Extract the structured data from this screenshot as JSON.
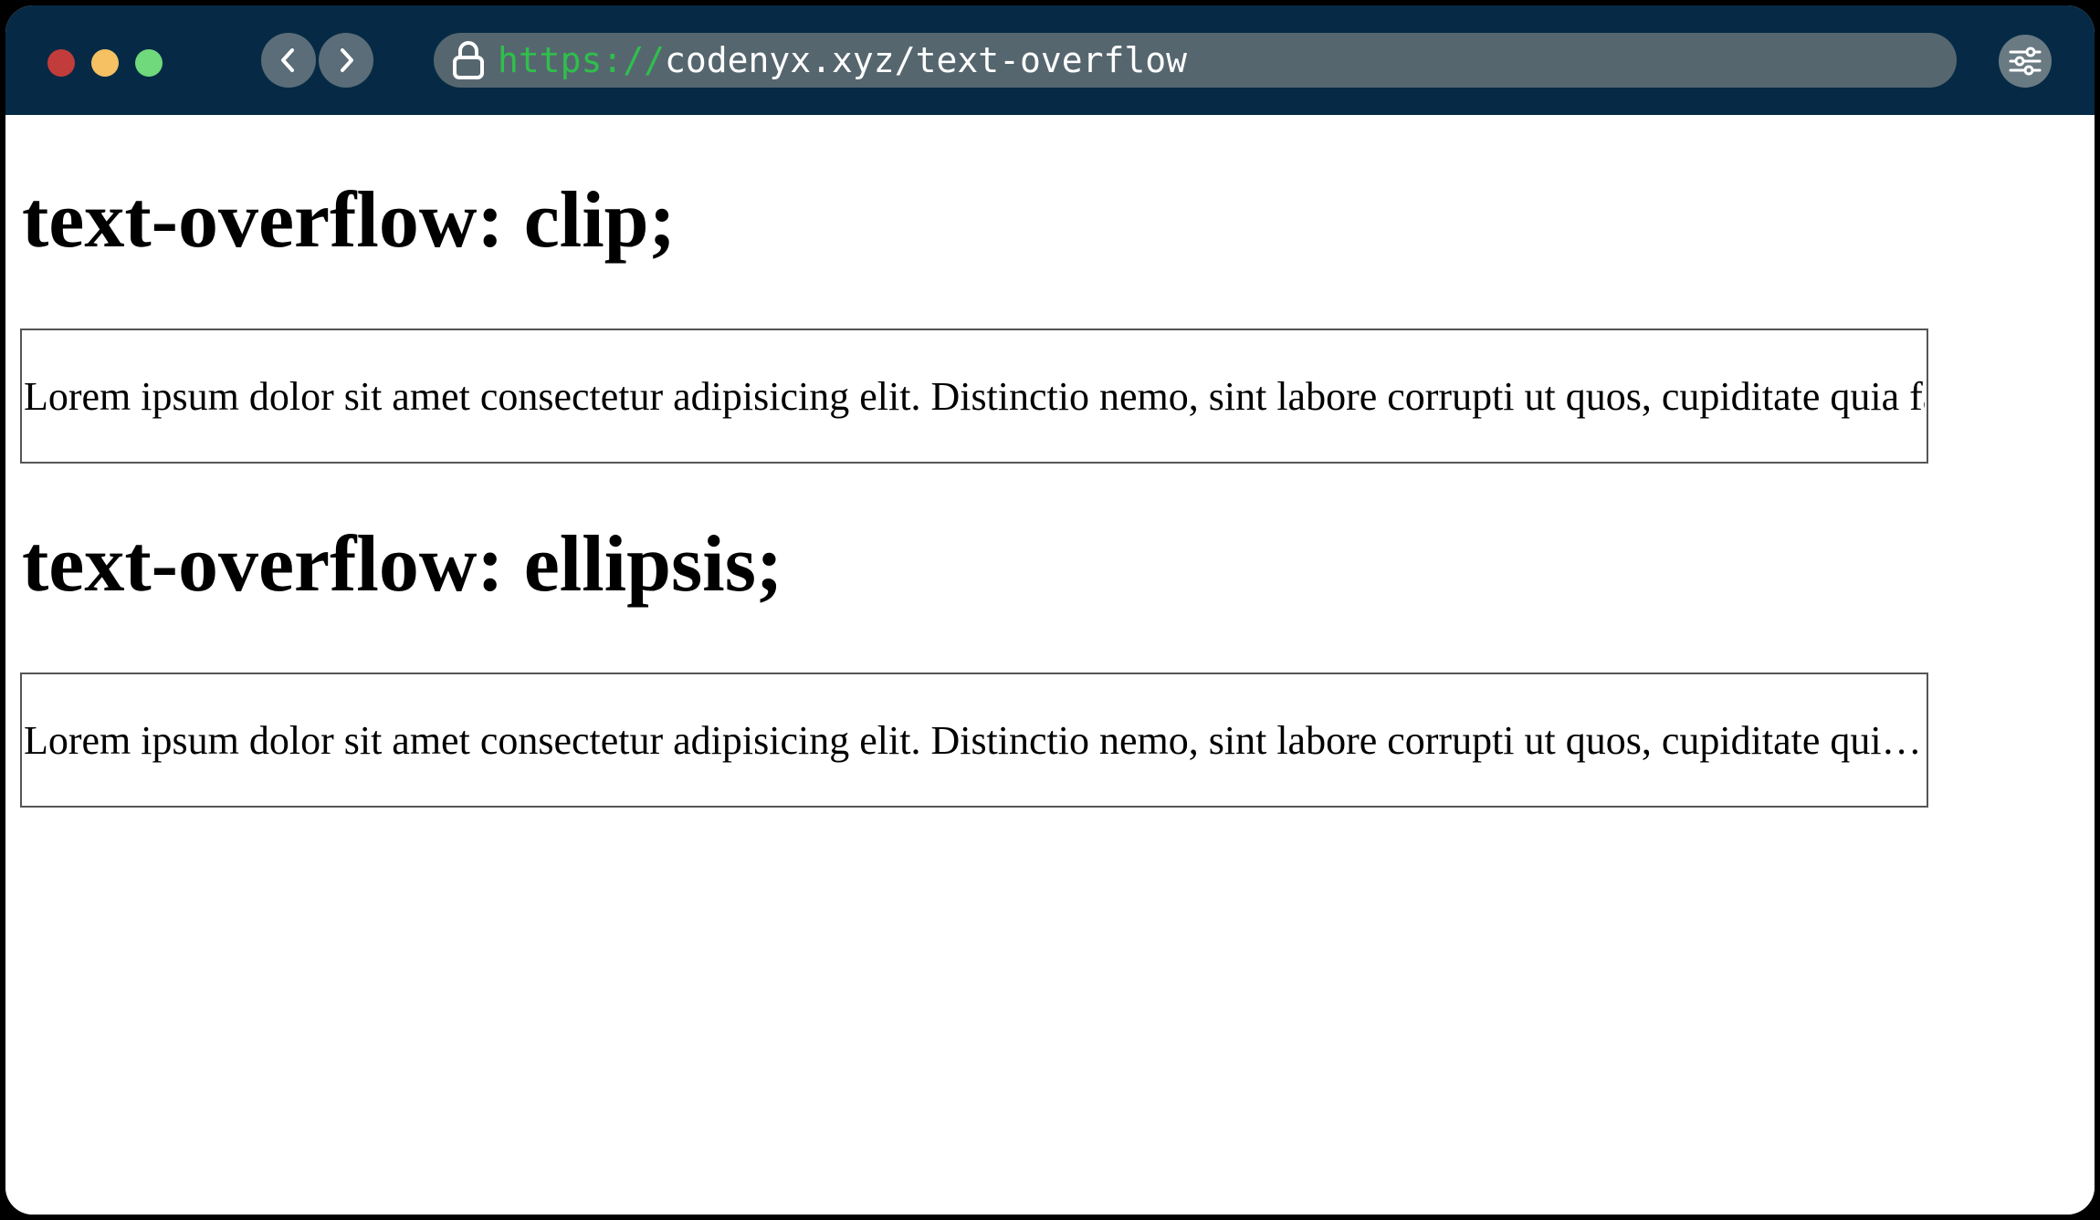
{
  "browser": {
    "traffic_lights": {
      "close_color": "#c23c3c",
      "minimize_color": "#f5c163",
      "zoom_color": "#6fd97c"
    },
    "nav": {
      "back_icon": "chevron-left-icon",
      "forward_icon": "chevron-right-icon"
    },
    "address_bar": {
      "lock_icon": "lock-icon",
      "scheme": "https://",
      "host_path": "codenyx.xyz/text-overflow"
    },
    "menu_icon": "sliders-icon",
    "titlebar_color": "#062a45"
  },
  "page": {
    "sections": [
      {
        "heading": "text-overflow: clip;",
        "box_text": "Lorem ipsum dolor sit amet consectetur adipisicing elit. Distinctio nemo, sint labore corrupti ut quos, cupiditate quia facilis"
      },
      {
        "heading": "text-overflow: ellipsis;",
        "box_text": "Lorem ipsum dolor sit amet consectetur adipisicing elit. Distinctio nemo, sint labore corrupti ut quos, cupiditate quia facilis"
      }
    ]
  }
}
